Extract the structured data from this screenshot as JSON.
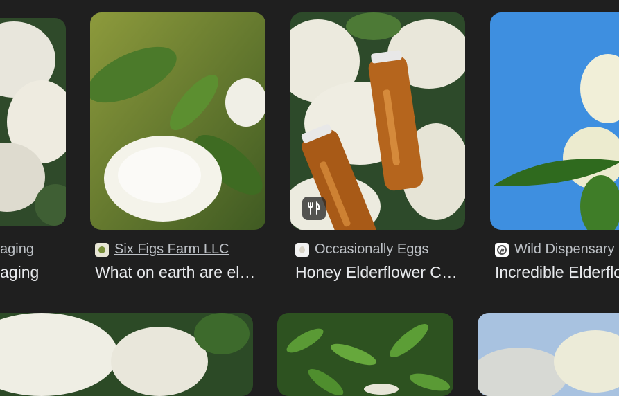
{
  "results": [
    {
      "source": "aging",
      "title": "aging"
    },
    {
      "source": "Six Figs Farm LLC",
      "title": "What on earth are elderberries?"
    },
    {
      "source": "Occasionally Eggs",
      "title": "Honey Elderflower Cordial"
    },
    {
      "source": "Wild Dispensary",
      "title": "Incredible Elderflower"
    }
  ],
  "badge": {
    "icon": "utensils-icon"
  }
}
